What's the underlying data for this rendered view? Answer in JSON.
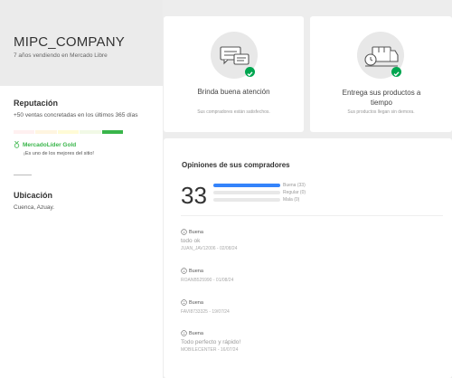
{
  "seller": {
    "name": "MIPC_COMPANY",
    "subtitle": "7 años vendiendo en Mercado Libre"
  },
  "reputation": {
    "title": "Reputación",
    "sales_text": "+50 ventas concretadas en los últimos 365 días",
    "thermometer_colors": [
      "#fff0f0",
      "#fff5e0",
      "#fffbd6",
      "#f1f9e6",
      "#39b54a"
    ],
    "active_level": 5,
    "leader_label": "MercadoLíder Gold",
    "leader_desc": "¡Es uno de los mejores del sitio!"
  },
  "location": {
    "title": "Ubicación",
    "value": "Cuenca, Azuay."
  },
  "cards": [
    {
      "icon": "chat-bubbles-icon",
      "title": "Brinda buena atención",
      "subtitle": "Sus compradores están satisfechos."
    },
    {
      "icon": "delivery-clock-icon",
      "title": "Entrega sus productos a tiempo",
      "subtitle": "Sus productos llegan sin demora."
    }
  ],
  "opinions": {
    "title": "Opiniones de sus compradores",
    "total": "33",
    "bars": [
      {
        "label": "Buena (33)",
        "fraction": 1.0
      },
      {
        "label": "Regular (0)",
        "fraction": 0.0
      },
      {
        "label": "Mala (0)",
        "fraction": 0.0
      }
    ],
    "reviews": [
      {
        "rating": "Buena",
        "comment": "todo ok",
        "meta": "JUAN_JAV12006 - 02/08/24"
      },
      {
        "rating": "Buena",
        "comment": "",
        "meta": "ROANB525990 - 01/08/24"
      },
      {
        "rating": "Buena",
        "comment": "",
        "meta": "FAVI8733325 - 19/07/24"
      },
      {
        "rating": "Buena",
        "comment": "Todo perfecto y rápido!",
        "meta": "MOBILECENTER - 16/07/24"
      }
    ]
  },
  "colors": {
    "accent_blue": "#3483fa",
    "success_green": "#00a650",
    "leader_green": "#39b54a"
  }
}
